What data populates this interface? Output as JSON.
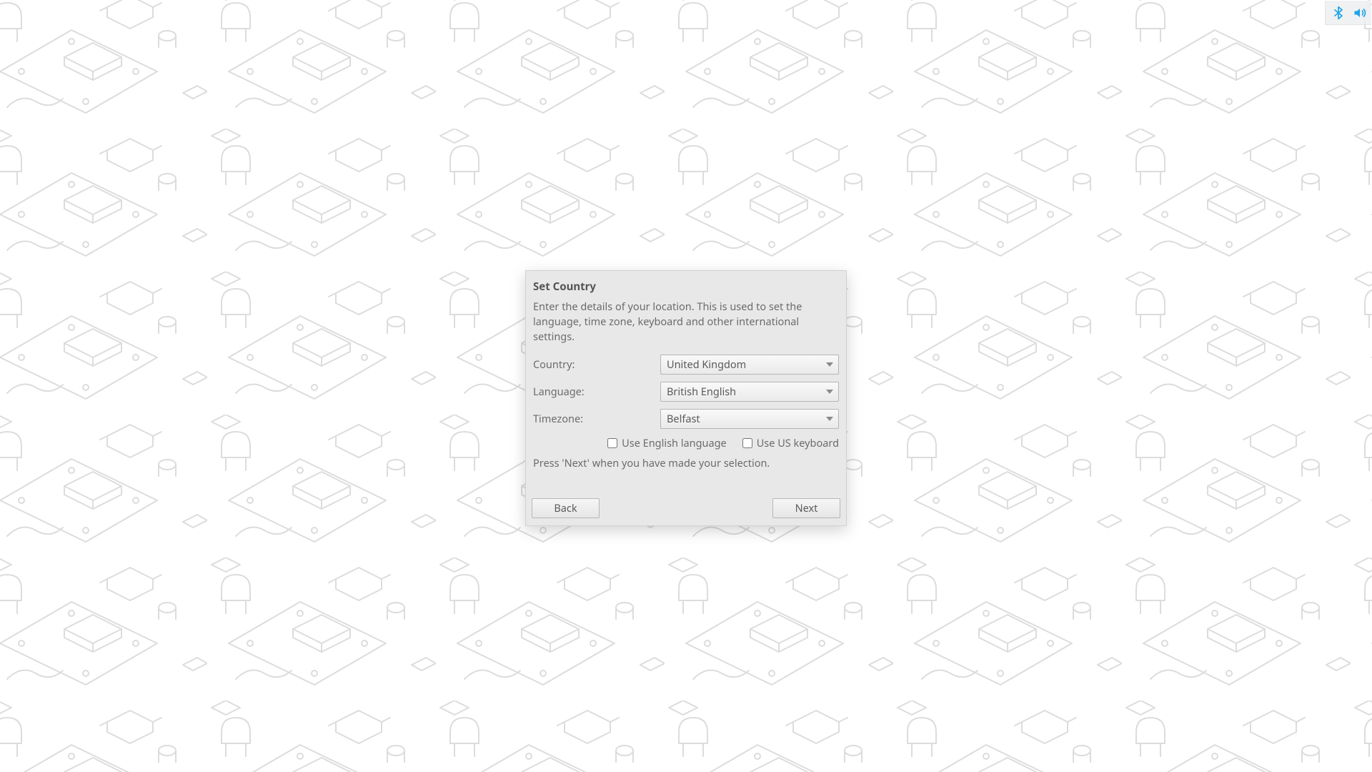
{
  "tray": {
    "bluetooth_name": "bluetooth-icon",
    "volume_name": "volume-icon",
    "accent": "#1aa3e8"
  },
  "dialog": {
    "title": "Set Country",
    "description": "Enter the details of your location. This is used to set the language, time zone, keyboard and other international settings.",
    "rows": {
      "country": {
        "label": "Country:",
        "value": "United Kingdom"
      },
      "language": {
        "label": "Language:",
        "value": "British English"
      },
      "timezone": {
        "label": "Timezone:",
        "value": "Belfast"
      }
    },
    "checks": {
      "english": {
        "label": "Use English language",
        "checked": false
      },
      "uskbd": {
        "label": "Use US keyboard",
        "checked": false
      }
    },
    "hint": "Press 'Next' when you have made your selection.",
    "buttons": {
      "back": "Back",
      "next": "Next"
    }
  }
}
